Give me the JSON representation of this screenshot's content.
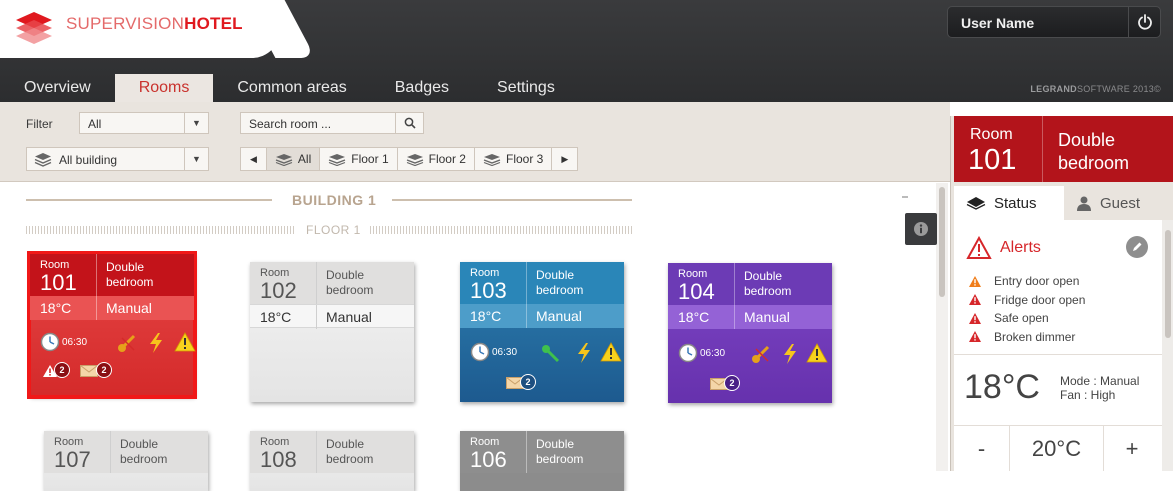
{
  "app": {
    "brand_light": "SUPERVISION",
    "brand_bold": "HOTEL",
    "user_name": "User Name",
    "credits_bold": "LEGRAND",
    "credits_rest": "SOFTWARE 2013©"
  },
  "nav": {
    "tabs": [
      "Overview",
      "Rooms",
      "Common areas",
      "Badges",
      "Settings"
    ],
    "active": "Rooms"
  },
  "filters": {
    "filter_label": "Filter",
    "filter_value": "All",
    "building_value": "All building",
    "search_placeholder": "Search room ...",
    "floors": [
      "All",
      "Floor 1",
      "Floor 2",
      "Floor 3"
    ],
    "selected_floor": "All"
  },
  "content": {
    "building_title": "BUILDING 1",
    "floor_title": "FLOOR 1"
  },
  "rooms": [
    {
      "label": "Room",
      "number": "101",
      "type_line1": "Double",
      "type_line2": "bedroom",
      "temp": "18°C",
      "mode": "Manual",
      "time": "06:30",
      "alert_count": "2",
      "message_count": "2",
      "theme": "red"
    },
    {
      "label": "Room",
      "number": "102",
      "type_line1": "Double",
      "type_line2": "bedroom",
      "temp": "18°C",
      "mode": "Manual",
      "theme": "grey"
    },
    {
      "label": "Room",
      "number": "103",
      "type_line1": "Double",
      "type_line2": "bedroom",
      "temp": "18°C",
      "mode": "Manual",
      "time": "06:30",
      "message_count": "2",
      "theme": "blue"
    },
    {
      "label": "Room",
      "number": "104",
      "type_line1": "Double",
      "type_line2": "bedroom",
      "temp": "18°C",
      "mode": "Manual",
      "time": "06:30",
      "message_count": "2",
      "theme": "purple"
    },
    {
      "label": "Room",
      "number": "107",
      "type_line1": "Double",
      "type_line2": "bedroom",
      "theme": "grey"
    },
    {
      "label": "Room",
      "number": "108",
      "type_line1": "Double",
      "type_line2": "bedroom",
      "theme": "grey"
    },
    {
      "label": "Room",
      "number": "106",
      "type_line1": "Double",
      "type_line2": "bedroom",
      "theme": "darkgrey"
    }
  ],
  "detail": {
    "room_label": "Room",
    "room_number": "101",
    "room_type_line1": "Double",
    "room_type_line2": "bedroom",
    "tab_status": "Status",
    "tab_guest": "Guest",
    "alerts_title": "Alerts",
    "alerts": [
      {
        "text": "Entry door open",
        "level": "warning"
      },
      {
        "text": "Fridge door open",
        "level": "critical"
      },
      {
        "text": "Safe open",
        "level": "critical"
      },
      {
        "text": "Broken dimmer",
        "level": "critical"
      }
    ],
    "current_temp": "18°C",
    "mode_line": "Mode : Manual",
    "fan_line": "Fan : High",
    "decrease": "-",
    "setpoint": "20°C",
    "increase": "+"
  },
  "colors": {
    "accent_red": "#c3131a",
    "room_blue": "#2a86b8",
    "room_purple": "#6c3bb5",
    "alert_orange": "#f07d1a",
    "alert_red": "#d6262a"
  }
}
